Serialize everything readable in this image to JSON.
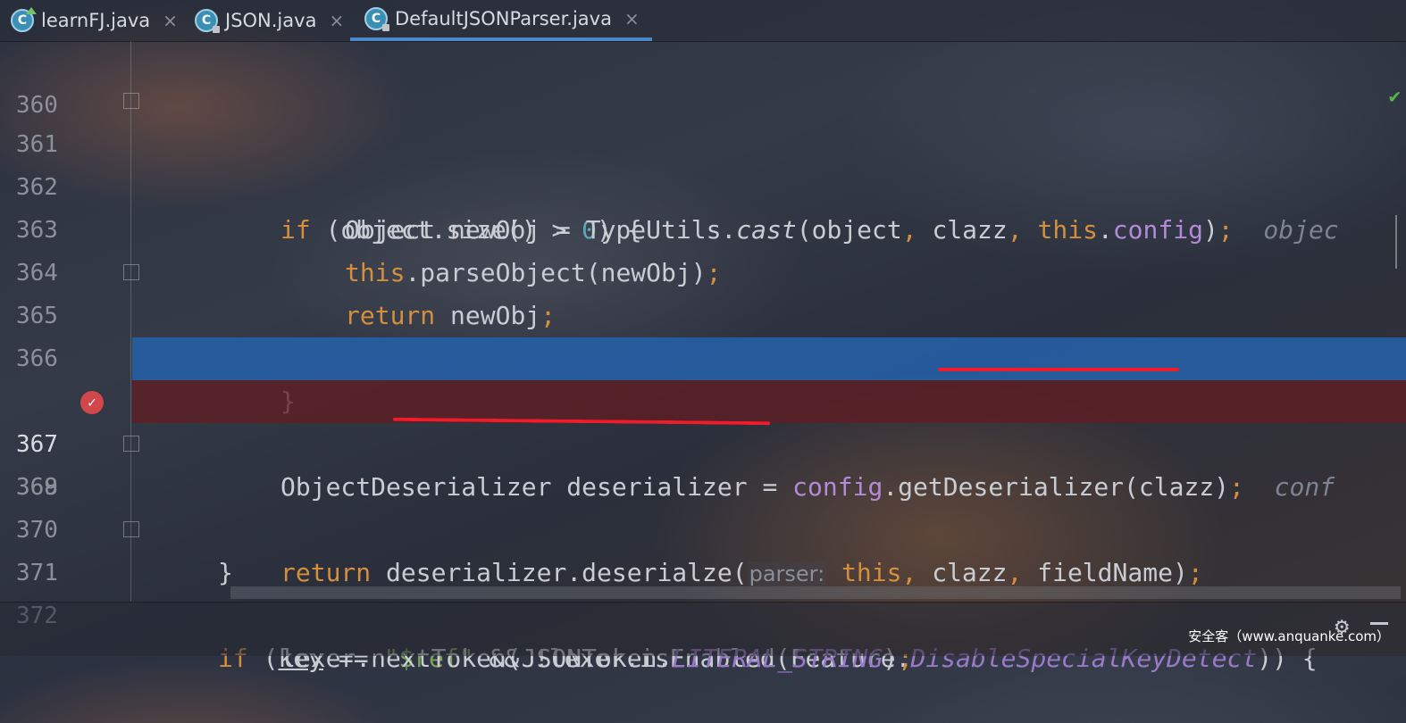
{
  "tabs": [
    {
      "label": "learnFJ.java",
      "close": "×",
      "icon": "java-class-icon"
    },
    {
      "label": "JSON.java",
      "close": "×",
      "icon": "java-class-icon"
    },
    {
      "label": "DefaultJSONParser.java",
      "close": "×",
      "icon": "java-class-icon",
      "active": true
    }
  ],
  "lines": [
    {
      "num": "360"
    },
    {
      "num": "361"
    },
    {
      "num": "362"
    },
    {
      "num": "363"
    },
    {
      "num": "364"
    },
    {
      "num": "365"
    },
    {
      "num": "366"
    },
    {
      "num": "367"
    },
    {
      "num": "368"
    },
    {
      "num": "369"
    },
    {
      "num": "370"
    },
    {
      "num": "371"
    },
    {
      "num": "372"
    }
  ],
  "code": {
    "l361": {
      "kw": "if",
      "a": " (object.size() > ",
      "num": "0",
      "b": ") {"
    },
    "l362": {
      "a": "Object newObj = TypeUtils.",
      "m": "cast",
      "b": "(object",
      "c1": ",",
      "d": " clazz",
      "c2": ",",
      "e": " ",
      "kw": "this",
      "f": ".",
      "fld": "config",
      "g": ")",
      "semi": ";",
      "hint": "  objec"
    },
    "l363": {
      "kw": "this",
      "a": ".parseObject(newObj)",
      "semi": ";"
    },
    "l364": {
      "kw": "return",
      "a": " newObj",
      "semi": ";"
    },
    "l365": {
      "a": "}"
    },
    "l367": {
      "a": "ObjectDeserializer deserializer = ",
      "fld": "config",
      "b": ".getDeserializer(clazz)",
      "semi": ";",
      "hint": "  conf"
    },
    "l368": {
      "kw": "return",
      "a": " deserializer.deserialze(",
      "param": "parser:",
      "kw2": "this",
      "c1": ",",
      "b": " clazz",
      "c2": ",",
      "c": " fieldName)",
      "semi": ";"
    },
    "l369": {
      "a": "}"
    },
    "l371": {
      "kw": "if",
      "a": " (",
      "key": "key",
      "b": " == ",
      "str": "\"$ref\"",
      "c": " && !lexer.isEnabled(Feature.",
      "const": "DisableSpecialKeyDetect",
      "d": ")) {"
    },
    "l372": {
      "a": "lexer.nextToken(JSONToken.",
      "const": "LITERAL_STRING",
      "b": ")",
      "semi": ";"
    }
  },
  "status": {
    "watermark": "安全客（www.anquanke.com）"
  },
  "colors": {
    "keyword": "#d48f3e",
    "field": "#b48ad8",
    "selection": "#2460a8",
    "breakpoint_line": "#601e22",
    "annotation": "#f01c2a"
  }
}
